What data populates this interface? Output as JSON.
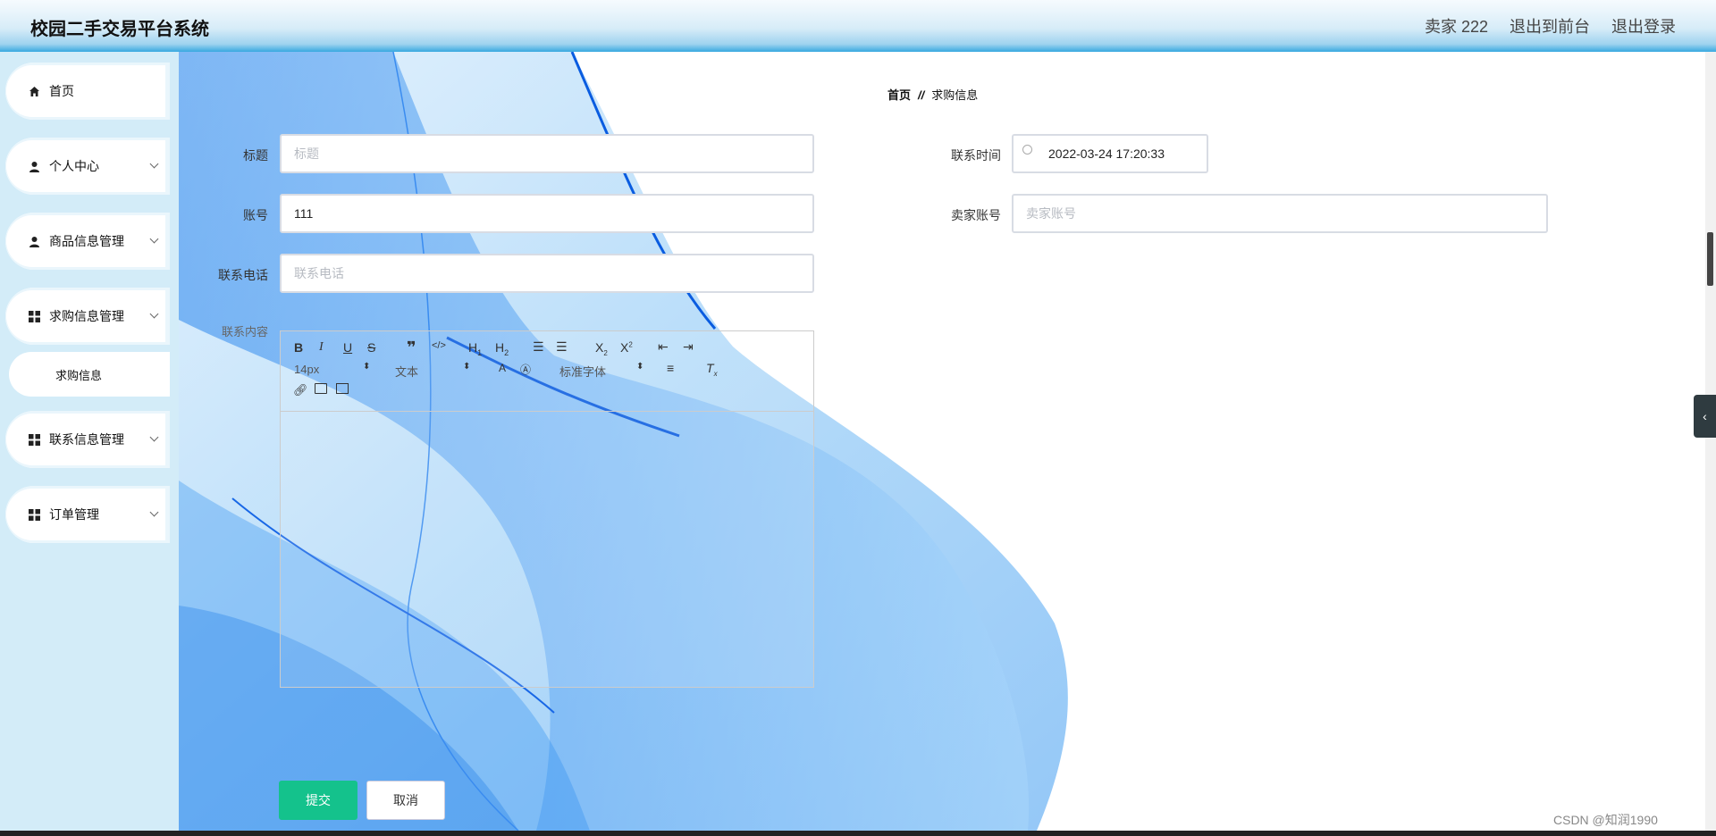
{
  "header": {
    "title": "校园二手交易平台系统",
    "user_label": "卖家 222",
    "to_front_label": "退出到前台",
    "logout_label": "退出登录"
  },
  "sidebar": {
    "items": [
      {
        "label": "首页",
        "icon": "home-icon"
      },
      {
        "label": "个人中心",
        "icon": "user-icon"
      },
      {
        "label": "商品信息管理",
        "icon": "user-icon"
      },
      {
        "label": "求购信息管理",
        "icon": "grid-icon"
      },
      {
        "label": "联系信息管理",
        "icon": "grid-icon"
      },
      {
        "label": "订单管理",
        "icon": "grid-icon"
      }
    ],
    "sub_item": "求购信息"
  },
  "breadcrumb": {
    "home": "首页",
    "separator": "//",
    "current": "求购信息"
  },
  "form": {
    "title_label": "标题",
    "title_placeholder": "标题",
    "account_label": "账号",
    "account_value": "111",
    "phone_label": "联系电话",
    "phone_placeholder": "联系电话",
    "content_label": "联系内容",
    "time_label": "联系时间",
    "time_value": "2022-03-24 17:20:33",
    "seller_label": "卖家账号",
    "seller_placeholder": "卖家账号"
  },
  "editor": {
    "font_size": "14px",
    "text_type": "文本",
    "font_family": "标准字体"
  },
  "buttons": {
    "submit": "提交",
    "cancel": "取消"
  },
  "watermark": "CSDN @知润1990",
  "colors": {
    "accent": "#14c28c",
    "sidebar_bg": "#d3ecf8",
    "header_bottom": "#38a9e0"
  }
}
